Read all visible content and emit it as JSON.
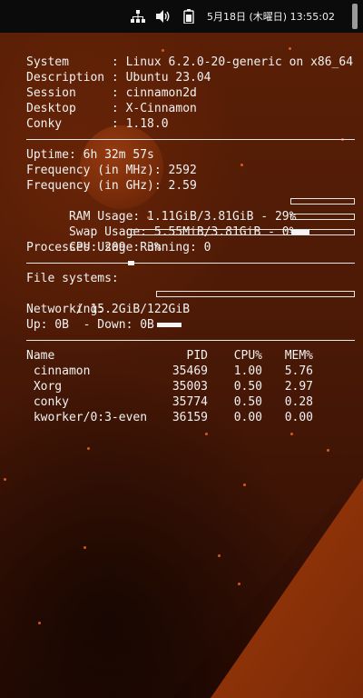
{
  "top_panel": {
    "icons": [
      "network-icon",
      "volume-icon",
      "battery-icon"
    ],
    "clock": "5月18日 (木曜日) 13:55:02"
  },
  "system": {
    "rows": [
      {
        "label": "System     ",
        "value": ": Linux 6.2.0-20-generic on x86_64"
      },
      {
        "label": "Description",
        "value": ": Ubuntu 23.04"
      },
      {
        "label": "Session    ",
        "value": ": cinnamon2d"
      },
      {
        "label": "Desktop    ",
        "value": ": X-Cinnamon"
      },
      {
        "label": "Conky      ",
        "value": ": 1.18.0"
      }
    ]
  },
  "stats": {
    "uptime": "Uptime: 6h 32m 57s",
    "freq_mhz": "Frequency (in MHz): 2592",
    "freq_ghz": "Frequency (in GHz): 2.59",
    "ram": "RAM Usage: 1.11GiB/3.81GiB - 29%",
    "ram_fraction": 0.29,
    "swap": "Swap Usage: 5.55MiB/3.81GiB - 0%",
    "swap_fraction": 0.0,
    "cpu": "CPU Usage: 3%",
    "cpu_fraction": 0.03,
    "processes": "Processes: 209  Running: 0"
  },
  "storage": {
    "fs_header": "File systems:",
    "root": " / 15.2GiB/122GiB",
    "root_fraction": 0.125,
    "net_header": "Networking:",
    "net": "Up: 0B  - Down: 0B"
  },
  "processes": {
    "headers": [
      "Name",
      "PID",
      "CPU%",
      "MEM%"
    ],
    "rows": [
      [
        "cinnamon",
        "35469",
        "1.00",
        "5.76"
      ],
      [
        "Xorg",
        "35003",
        "0.50",
        "2.97"
      ],
      [
        "conky",
        "35774",
        "0.50",
        "0.28"
      ],
      [
        "kworker/0:3-even",
        "36159",
        "0.00",
        "0.00"
      ]
    ]
  }
}
